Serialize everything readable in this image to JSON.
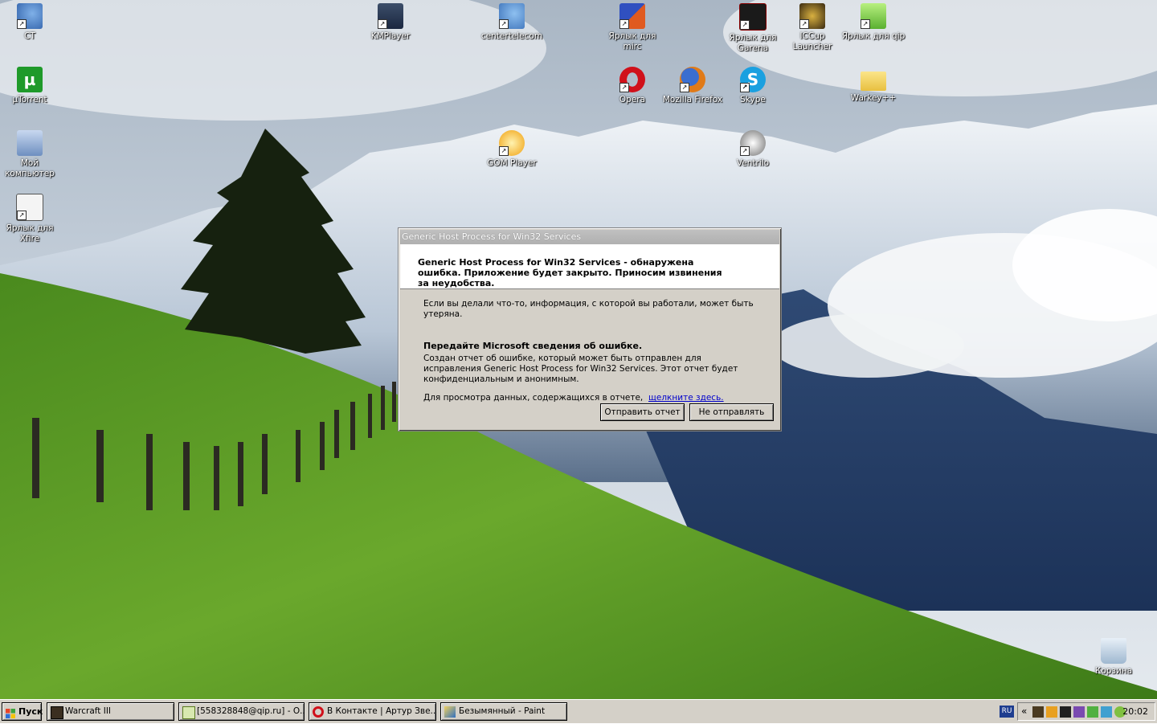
{
  "desktop": {
    "icons": [
      {
        "id": "ct",
        "label": "CT"
      },
      {
        "id": "kmplayer",
        "label": "KMPlayer"
      },
      {
        "id": "centertelecom",
        "label": "centertelecom"
      },
      {
        "id": "mirc",
        "label": "Ярлык для mirc"
      },
      {
        "id": "garena",
        "label": "Ярлык для Garena"
      },
      {
        "id": "iccup",
        "label": "ICCup Launcher"
      },
      {
        "id": "qip",
        "label": "Ярлык для qip"
      },
      {
        "id": "utorrent",
        "label": "µTorrent"
      },
      {
        "id": "opera",
        "label": "Opera"
      },
      {
        "id": "firefox",
        "label": "Mozilla Firefox"
      },
      {
        "id": "skype",
        "label": "Skype"
      },
      {
        "id": "warkey",
        "label": "Warkey++"
      },
      {
        "id": "mycomputer",
        "label": "Мой компьютер"
      },
      {
        "id": "gom",
        "label": "GOM Player"
      },
      {
        "id": "ventrilo",
        "label": "Ventrilo"
      },
      {
        "id": "xfire",
        "label": "Ярлык для Xfire"
      },
      {
        "id": "recycle",
        "label": "Корзина"
      }
    ]
  },
  "dialog": {
    "title": "Generic Host Process for Win32 Services",
    "header": "Generic Host Process for Win32 Services - обнаружена ошибка. Приложение будет закрыто. Приносим извинения за неудобства.",
    "info": "Если вы делали что-то, информация, с которой вы работали, может быть утеряна.",
    "subheading": "Передайте Microsoft сведения об ошибке.",
    "report_text": "Создан отчет об ошибке, который может быть отправлен для исправления Generic Host Process for Win32 Services. Этот отчет будет конфиденциальным и анонимным.",
    "view_text": "Для просмотра данных, содержащихся в отчете,",
    "view_link": "щелкните здесь.",
    "send_button": "Отправить отчет",
    "dont_send_button": "Не отправлять"
  },
  "taskbar": {
    "start_label": "Пуск",
    "tasks": [
      {
        "label": "Warcraft III"
      },
      {
        "label": "[558328848@qip.ru] - О..."
      },
      {
        "label": "В Контакте | Артур Зве..."
      },
      {
        "label": "Безымянный - Paint"
      }
    ],
    "language": "RU",
    "tray_expand": "«",
    "clock": "20:02"
  }
}
